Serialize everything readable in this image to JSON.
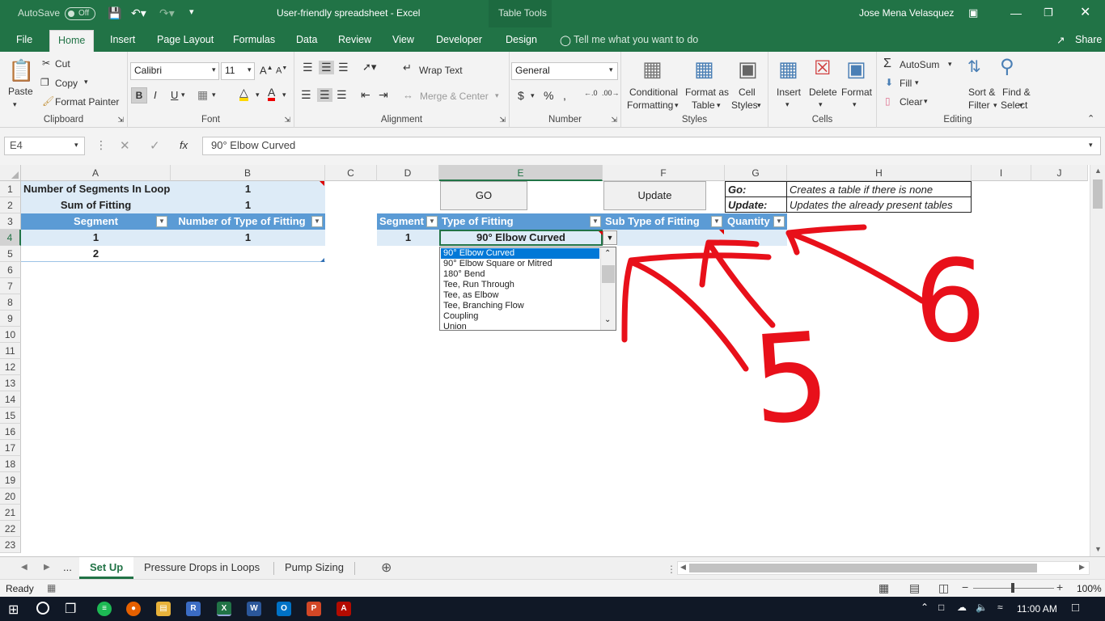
{
  "window": {
    "autosave_label": "AutoSave",
    "autosave_state": "Off",
    "title": "User-friendly spreadsheet  -  Excel",
    "context_tools": "Table Tools",
    "user": "Jose Mena Velasquez"
  },
  "ribbon_tabs": [
    "File",
    "Home",
    "Insert",
    "Page Layout",
    "Formulas",
    "Data",
    "Review",
    "View",
    "Developer",
    "Design"
  ],
  "tell_me": "Tell me what you want to do",
  "share": "Share",
  "clipboard": {
    "paste": "Paste",
    "cut": "Cut",
    "copy": "Copy",
    "format_painter": "Format Painter",
    "label": "Clipboard"
  },
  "font": {
    "name": "Calibri",
    "size": "11",
    "bold": "B",
    "italic": "I",
    "underline": "U",
    "label": "Font"
  },
  "alignment": {
    "wrap": "Wrap Text",
    "merge": "Merge & Center",
    "label": "Alignment"
  },
  "number": {
    "format": "General",
    "label": "Number"
  },
  "styles": {
    "conditional_1": "Conditional",
    "conditional_2": "Formatting",
    "format_table_1": "Format as",
    "format_table_2": "Table",
    "cell_styles_1": "Cell",
    "cell_styles_2": "Styles",
    "label": "Styles"
  },
  "cells": {
    "insert": "Insert",
    "delete": "Delete",
    "format": "Format",
    "label": "Cells"
  },
  "editing": {
    "autosum": "AutoSum",
    "fill": "Fill",
    "clear": "Clear",
    "sort_1": "Sort &",
    "sort_2": "Filter",
    "find_1": "Find &",
    "find_2": "Select",
    "label": "Editing"
  },
  "formula_bar": {
    "name_box": "E4",
    "fx": "fx",
    "value": "90° Elbow Curved"
  },
  "columns": [
    "A",
    "B",
    "C",
    "D",
    "E",
    "F",
    "G",
    "H",
    "I",
    "J"
  ],
  "rows": [
    "1",
    "2",
    "3",
    "4",
    "5",
    "6",
    "7",
    "8",
    "9",
    "10",
    "11",
    "12",
    "13",
    "14",
    "15",
    "16",
    "17",
    "18",
    "19",
    "20",
    "21",
    "22",
    "23"
  ],
  "sheet": {
    "a1": "Number of Segments In Loop",
    "b1": "1",
    "a2": "Sum of Fitting",
    "b2": "1",
    "table1_headers": [
      "Segment",
      "Number of Type of Fitting"
    ],
    "table1_rows": [
      [
        "1",
        "1"
      ],
      [
        "2",
        ""
      ]
    ],
    "go_button": "GO",
    "update_button": "Update",
    "table2_headers": [
      "Segment",
      "Type of Fitting",
      "Sub Type of Fitting",
      "Quantity"
    ],
    "table2_row": [
      "1",
      "90° Elbow Curved",
      "",
      ""
    ],
    "notes": [
      {
        "key": "Go:",
        "text": "Creates a table if there is none"
      },
      {
        "key": "Update:",
        "text": "Updates the already present tables"
      }
    ]
  },
  "dropdown_options": [
    "90° Elbow Curved",
    "90° Elbow Square or Mitred",
    "180° Bend",
    "Tee, Run Through",
    "Tee, as Elbow",
    "Tee, Branching Flow",
    "Coupling",
    "Union"
  ],
  "annotations": {
    "five": "5",
    "six": "6",
    "color": "#e8101a"
  },
  "sheet_tabs": {
    "ellipsis": "...",
    "tabs": [
      "Set Up",
      "Pressure Drops in Loops",
      "Pump Sizing"
    ],
    "active": "Set Up"
  },
  "status": {
    "ready": "Ready",
    "zoom": "100%"
  },
  "taskbar": {
    "time": "11:00 AM"
  },
  "colors": {
    "excel_green": "#217346",
    "table_header": "#5b9bd5",
    "table_band": "#ddebf7",
    "selection_blue": "#0078d7"
  }
}
